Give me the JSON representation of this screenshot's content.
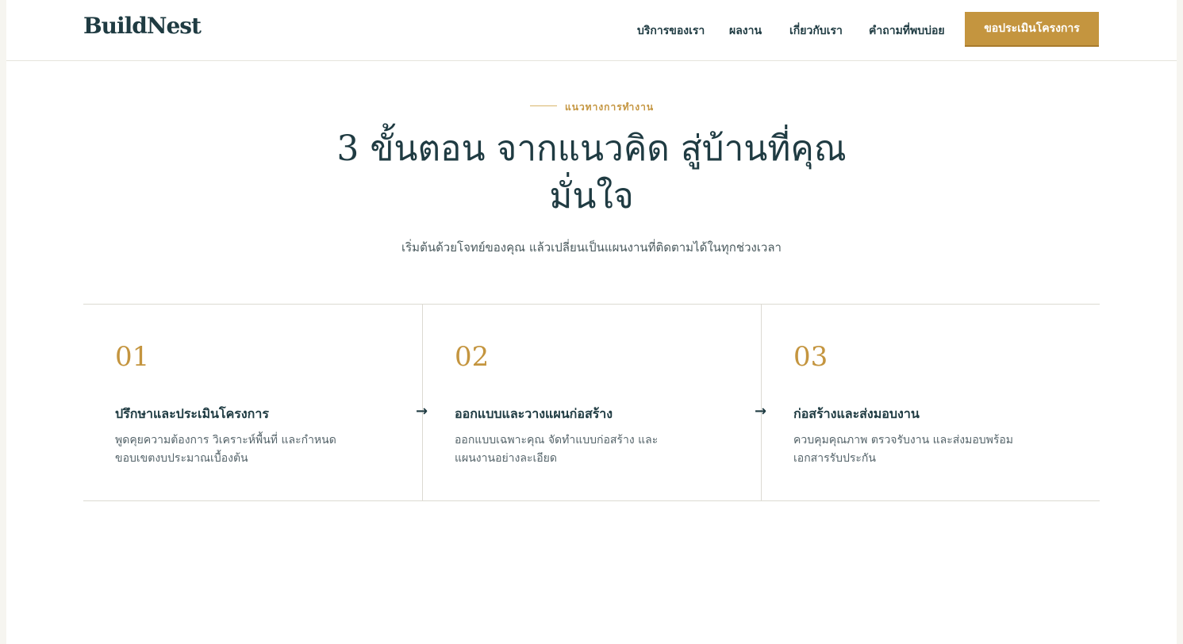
{
  "header": {
    "logo": "BuildNest",
    "nav": [
      "บริการของเรา",
      "ผลงาน",
      "เกี่ยวกับเรา",
      "คำถามที่พบบ่อย"
    ],
    "cta": "ขอประเมินโครงการ"
  },
  "hero": {
    "eyebrow": "แนวทางการทำงาน",
    "title_line1": "3 ขั้นตอน จากแนวคิด สู่บ้านที่คุณ",
    "title_line2": "มั่นใจ",
    "subtitle": "เริ่มต้นด้วยโจทย์ของคุณ แล้วเปลี่ยนเป็นแผนงานที่ติดตามได้ในทุกช่วงเวลา"
  },
  "steps": [
    {
      "number": "01",
      "title": "ปรึกษาและประเมินโครงการ",
      "desc": "พูดคุยความต้องการ วิเคราะห์พื้นที่ และกำหนดขอบเขตงบประมาณเบื้องต้น"
    },
    {
      "number": "02",
      "title": "ออกแบบและวางแผนก่อสร้าง",
      "desc": "ออกแบบเฉพาะคุณ จัดทำแบบก่อสร้าง และแผนงานอย่างละเอียด"
    },
    {
      "number": "03",
      "title": "ก่อสร้างและส่งมอบงาน",
      "desc": "ควบคุมคุณภาพ ตรวจรับงาน และส่งมอบพร้อมเอกสารรับประกัน"
    }
  ],
  "icons": {
    "arrow": "arrow-right-icon"
  },
  "colors": {
    "accent": "#c4953f",
    "primary": "#1f3b42"
  }
}
